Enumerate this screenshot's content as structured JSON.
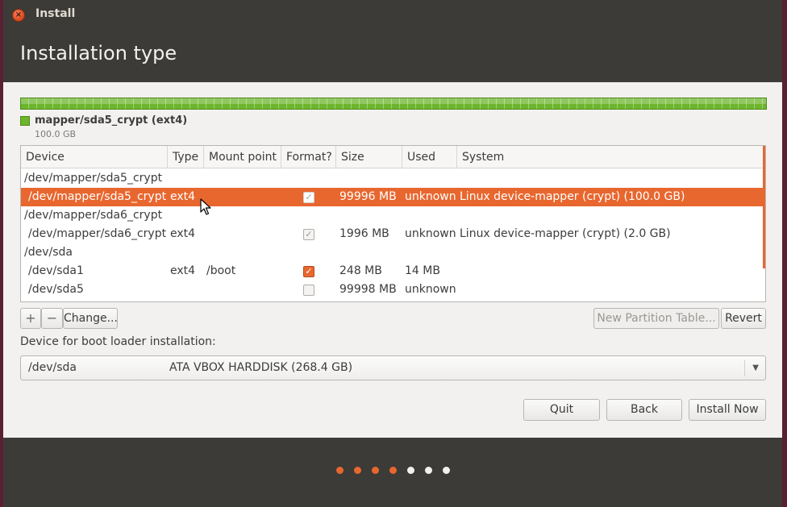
{
  "window": {
    "title": "Install",
    "heading": "Installation type"
  },
  "partition_legend": {
    "name": "mapper/sda5_crypt (ext4)",
    "size": "100.0 GB",
    "color": "#6db52c"
  },
  "table": {
    "columns": [
      "Device",
      "Type",
      "Mount point",
      "Format?",
      "Size",
      "Used",
      "System"
    ],
    "rows": [
      {
        "kind": "group",
        "device": "/dev/mapper/sda5_crypt"
      },
      {
        "kind": "partition",
        "device": "/dev/mapper/sda5_crypt",
        "type": "ext4",
        "mount": "",
        "format": "checked",
        "size": "99996 MB",
        "used": "unknown",
        "system": "Linux device-mapper (crypt) (100.0 GB)",
        "selected": true
      },
      {
        "kind": "group",
        "device": "/dev/mapper/sda6_crypt"
      },
      {
        "kind": "partition",
        "device": "/dev/mapper/sda6_crypt",
        "type": "ext4",
        "mount": "",
        "format": "checked-disabled",
        "size": "1996 MB",
        "used": "unknown",
        "system": "Linux device-mapper (crypt) (2.0 GB)",
        "selected": false
      },
      {
        "kind": "group",
        "device": "/dev/sda"
      },
      {
        "kind": "partition",
        "device": "/dev/sda1",
        "type": "ext4",
        "mount": "/boot",
        "format": "checked",
        "size": "248 MB",
        "used": "14 MB",
        "system": "",
        "selected": false
      },
      {
        "kind": "partition",
        "device": "/dev/sda5",
        "type": "",
        "mount": "",
        "format": "unchecked",
        "size": "99998 MB",
        "used": "unknown",
        "system": "",
        "selected": false
      }
    ]
  },
  "toolbar": {
    "add_icon": "+",
    "remove_icon": "−",
    "change_label": "Change...",
    "new_table_label": "New Partition Table...",
    "revert_label": "Revert"
  },
  "bootloader": {
    "label": "Device for boot loader installation:",
    "device": "/dev/sda",
    "description": "ATA VBOX HARDDISK (268.4 GB)",
    "dropdown_icon": "▼"
  },
  "actions": {
    "quit_label": "Quit",
    "back_label": "Back",
    "install_label": "Install Now"
  },
  "progress": {
    "total_steps": 7,
    "completed_steps": 4,
    "done_color": "#e8672f",
    "todo_color": "#f2f1f0"
  },
  "colors": {
    "accent": "#e8672f",
    "header_bg": "#3c3b37",
    "window_bg": "#f2f1f0"
  }
}
